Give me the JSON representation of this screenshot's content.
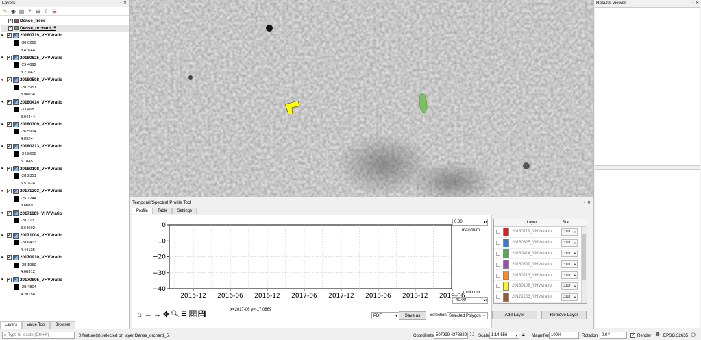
{
  "layers_panel": {
    "title": "Layers",
    "toolbar_icons": [
      "paint-icon",
      "eye-icon",
      "filter-icon",
      "filter-legend-icon",
      "expand-icon",
      "collapse-icon",
      "remove-icon"
    ],
    "vector_layers": [
      {
        "name": "Dense_trees",
        "color": "#a0522d",
        "underlined": false
      },
      {
        "name": "Dense_orchard_5",
        "color": "#6aa84f",
        "underlined": true
      }
    ],
    "raster_layers": [
      {
        "name": "20180719_VHVVratio",
        "min": "-30.6269",
        "max": "3.47644"
      },
      {
        "name": "20180625_VHVVratio",
        "min": "-29.4692",
        "max": "3.21042"
      },
      {
        "name": "20180508_VHVVratio",
        "min": "-28.3951",
        "max": "3.96034"
      },
      {
        "name": "20180414_VHVVratio",
        "min": "-33.468",
        "max": "3.04444"
      },
      {
        "name": "20180309_VHVVratio",
        "min": "-26.5914",
        "max": "4.0924"
      },
      {
        "name": "20180213_VHVVratio",
        "min": "-24.8609",
        "max": "5.1845"
      },
      {
        "name": "20180108_VHVVratio",
        "min": "-28.2351",
        "max": "5.51624"
      },
      {
        "name": "20171203_VHVVratio",
        "min": "-25.7244",
        "max": "3.6089"
      },
      {
        "name": "20171109_VHVVratio",
        "min": "-28.313",
        "max": "8.64692"
      },
      {
        "name": "20171004_VHVVratio",
        "min": "-28.6403",
        "max": "4.44125"
      },
      {
        "name": "20170910_VHVVratio",
        "min": "-28.1959",
        "max": "4.66312"
      },
      {
        "name": "20170805_VHVVratio",
        "min": "-28.4804",
        "max": "4.20158"
      }
    ],
    "bottom_tabs": [
      "Layers",
      "Value Tool",
      "Browser"
    ]
  },
  "results_viewer": {
    "title": "Results Viewer"
  },
  "profile_tool": {
    "title": "Temporal/Spectral Profile Tool",
    "tabs": [
      "Profile",
      "Table",
      "Settings"
    ],
    "max_value": "0.00",
    "max_label": "maximum",
    "min_value": "-40.00",
    "min_label": "minimum",
    "cursor_readout": "x=2017-06 y=-17.0869",
    "export_format": "PDF",
    "save_as_label": "Save as",
    "selection_label": "Selection",
    "selection_value": "Selected Polygon",
    "layer_table_headers": [
      "Layer",
      "Stat"
    ],
    "layer_rows": [
      {
        "name": "20180719_VHVVratio",
        "color": "#e02020",
        "stat": "coun"
      },
      {
        "name": "20180625_VHVVratio",
        "color": "#3a7ccc",
        "stat": "coun"
      },
      {
        "name": "20180414_VHVVratio",
        "color": "#4caf50",
        "stat": "coun"
      },
      {
        "name": "20180309_VHVVratio",
        "color": "#9c4fb0",
        "stat": "coun"
      },
      {
        "name": "20180213_VHVVratio",
        "color": "#ff8c1a",
        "stat": "coun"
      },
      {
        "name": "20180108_VHVVratio",
        "color": "#f5f52a",
        "stat": "coun"
      },
      {
        "name": "20171203_VHVVratio",
        "color": "#9a5a2a",
        "stat": "coun"
      }
    ],
    "add_layer_label": "Add Layer",
    "remove_layer_label": "Remove Layer"
  },
  "chart_data": {
    "type": "line",
    "title": "",
    "xlabel": "",
    "ylabel": "",
    "ylim": [
      -40,
      0
    ],
    "yticks": [
      "0",
      "−10",
      "−20",
      "−30",
      "−40"
    ],
    "xticks": [
      "2015-12",
      "2016-06",
      "2016-12",
      "2017-06",
      "2017-12",
      "2018-06",
      "2018-12",
      "2019-06"
    ],
    "series": []
  },
  "status_bar": {
    "locate_placeholder": "Type to locate (Ctrl+K)",
    "message": "0 feature(s) selected on layer Dense_orchard_5.",
    "coordinate_label": "Coordinate",
    "coordinate_value": "507999,4378889",
    "scale_label": "Scale",
    "scale_value": "1:14,556",
    "magnifier_label": "Magnifier",
    "magnifier_value": "100%",
    "rotation_label": "Rotation",
    "rotation_value": "0.0 °",
    "render_label": "Render",
    "crs_label": "EPSG:32635"
  }
}
